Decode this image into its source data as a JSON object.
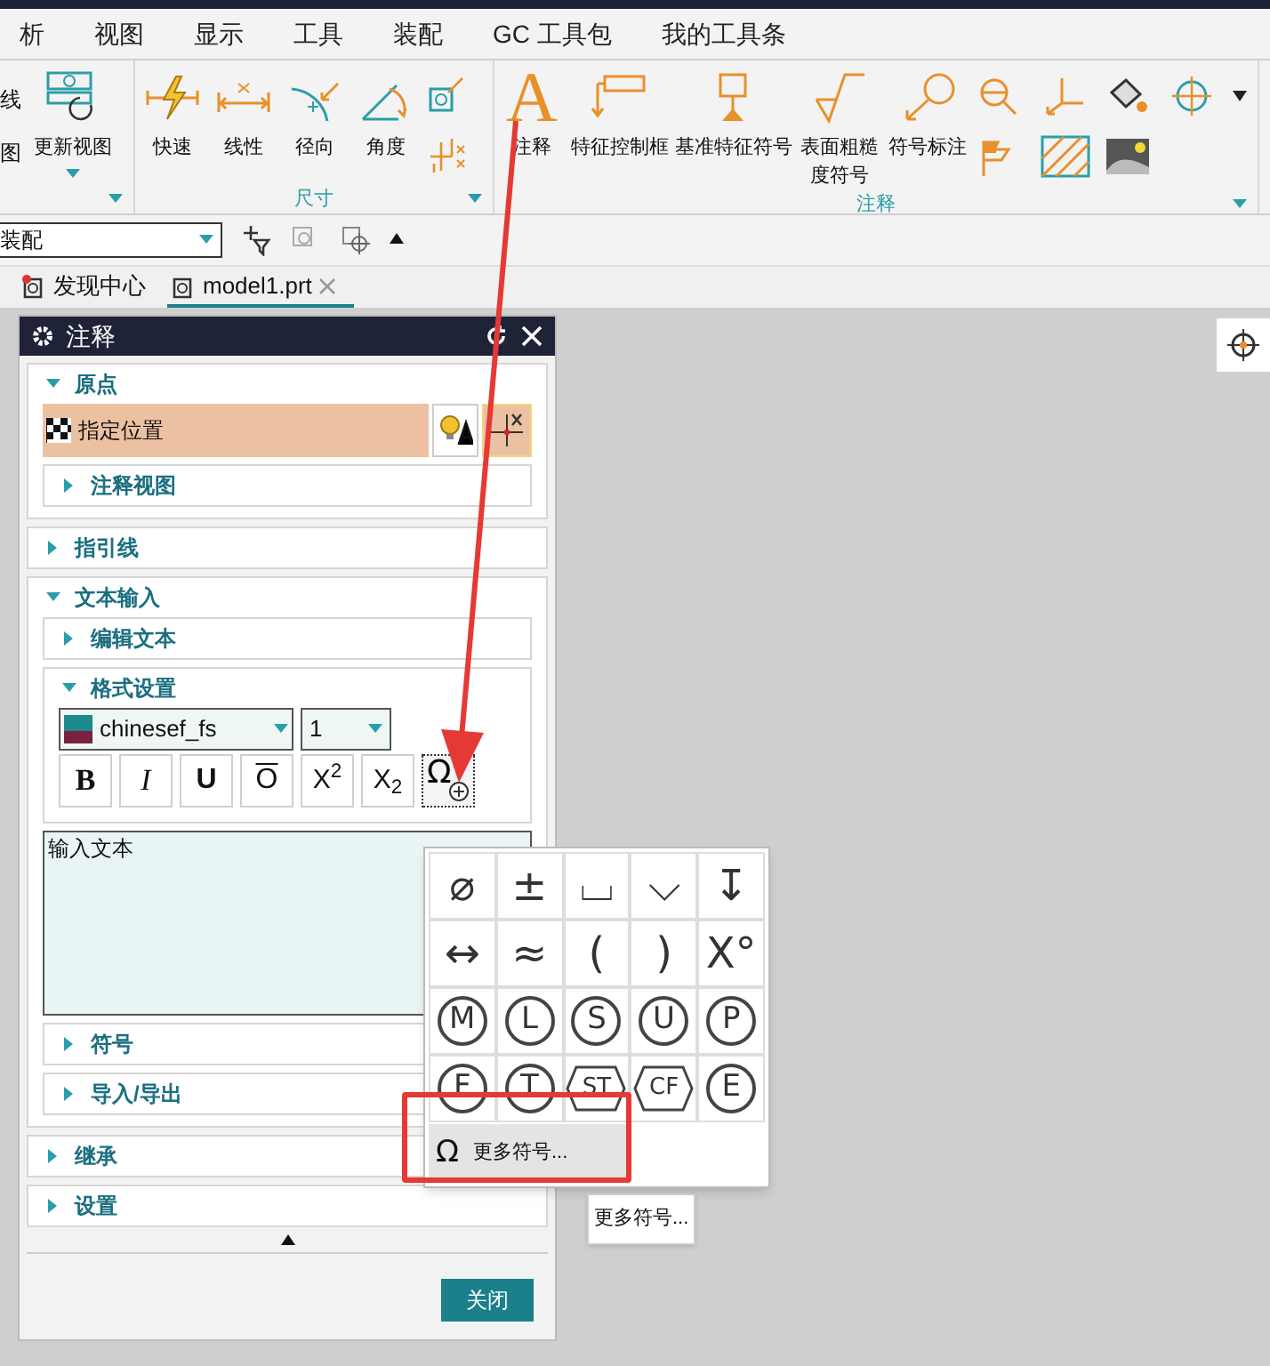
{
  "menu_tabs": [
    {
      "label": "析"
    },
    {
      "label": "视图"
    },
    {
      "label": "显示"
    },
    {
      "label": "工具"
    },
    {
      "label": "装配"
    },
    {
      "label": "GC 工具包"
    },
    {
      "label": "我的工具条"
    }
  ],
  "ribbon": {
    "groups": [
      {
        "items": [
          {
            "label": "线",
            "kind": "small",
            "has_menu": false
          },
          {
            "label": "图",
            "kind": "small",
            "has_menu": false
          },
          {
            "label": "更新视图",
            "kind": "large",
            "has_menu": true
          }
        ]
      },
      {
        "label": "尺寸",
        "items": [
          {
            "label": "快速",
            "kind": "large",
            "has_menu": false
          },
          {
            "label": "线性",
            "kind": "large",
            "has_menu": false
          },
          {
            "label": "径向",
            "kind": "large",
            "has_menu": false
          },
          {
            "label": "角度",
            "kind": "large",
            "has_menu": false
          }
        ]
      },
      {
        "label": "注释",
        "items": [
          {
            "label": "注释",
            "kind": "large",
            "has_menu": false,
            "glyph": "A"
          },
          {
            "label": "特征控制框",
            "kind": "large",
            "has_menu": false
          },
          {
            "label": "基准特征符号",
            "kind": "large",
            "has_menu": false
          },
          {
            "label": "表面粗糙度符号",
            "kind": "large",
            "has_menu": false
          },
          {
            "label": "符号标注",
            "kind": "large",
            "has_menu": false
          }
        ]
      }
    ]
  },
  "toolbar": {
    "filter": "装配"
  },
  "doc_tabs": [
    {
      "label": "发现中心",
      "selected": false
    },
    {
      "label": "model1.prt",
      "selected": true
    }
  ],
  "dialog": {
    "title": "注释",
    "sections": [
      {
        "title": "原点",
        "expanded": true,
        "children": [
          {
            "kind": "location",
            "label": "指定位置",
            "active": true
          },
          {
            "kind": "subsection",
            "title": "注释视图",
            "expanded": false
          }
        ]
      },
      {
        "title": "指引线",
        "expanded": false
      },
      {
        "title": "文本输入",
        "expanded": true,
        "children": [
          {
            "kind": "subsection",
            "title": "编辑文本",
            "expanded": false
          },
          {
            "kind": "format",
            "title": "格式设置",
            "expanded": true,
            "font": "chinesef_fs",
            "size": "1",
            "buttons": [
              {
                "kind": "bold",
                "label": "B"
              },
              {
                "kind": "italic",
                "label": "I"
              },
              {
                "kind": "underline",
                "label": "U"
              },
              {
                "kind": "overline",
                "label": "O"
              },
              {
                "kind": "script",
                "label": "X$^{2}$"
              },
              {
                "kind": "script",
                "label": "X$_{2}$"
              },
              {
                "kind": "symbol",
                "label": "Ω"
              }
            ]
          },
          {
            "kind": "textarea",
            "value": "输入文本"
          },
          {
            "kind": "subsection",
            "title": "符号",
            "expanded": false
          },
          {
            "kind": "subsection",
            "title": "导入/导出",
            "expanded": false
          }
        ]
      },
      {
        "title": "继承",
        "expanded": false
      },
      {
        "title": "设置",
        "expanded": false
      }
    ],
    "close": "关闭"
  },
  "symbol_popup": {
    "symbols": [
      {
        "kind": "glyph",
        "text": "⌀"
      },
      {
        "kind": "glyph",
        "text": "±"
      },
      {
        "kind": "glyph",
        "text": "⌴"
      },
      {
        "kind": "glyph",
        "text": "⌵"
      },
      {
        "kind": "glyph",
        "text": "↧"
      },
      {
        "kind": "glyph",
        "text": "↔"
      },
      {
        "kind": "glyph",
        "text": "≈"
      },
      {
        "kind": "glyph",
        "text": "("
      },
      {
        "kind": "glyph",
        "text": ")"
      },
      {
        "kind": "glyph",
        "text": "X°"
      },
      {
        "kind": "circle",
        "text": "M"
      },
      {
        "kind": "circle",
        "text": "L"
      },
      {
        "kind": "circle",
        "text": "S"
      },
      {
        "kind": "circle",
        "text": "U"
      },
      {
        "kind": "circle",
        "text": "P"
      },
      {
        "kind": "circle",
        "text": "F"
      },
      {
        "kind": "circle",
        "text": "T"
      },
      {
        "kind": "hex",
        "text": "ST"
      },
      {
        "kind": "hex",
        "text": "CF"
      },
      {
        "kind": "circle",
        "text": "E"
      }
    ],
    "more_glyph": "Ω",
    "more": "更多符号...",
    "tooltip": "更多符号..."
  }
}
